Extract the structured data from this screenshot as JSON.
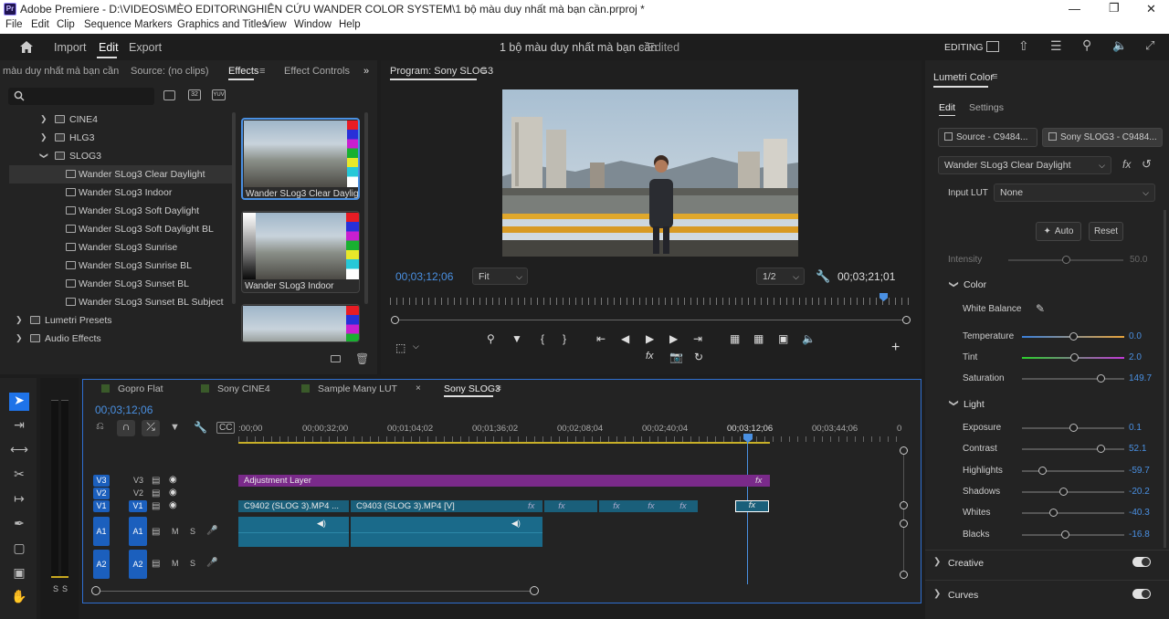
{
  "title_bar": {
    "text": "Adobe Premiere - D:\\VIDEOS\\MÈO EDITOR\\NGHIÊN CỨU WANDER COLOR SYSTEM\\1 bộ màu duy nhất mà bạn cần.prproj *",
    "app_icon": "Pr"
  },
  "menu": [
    "File",
    "Edit",
    "Clip",
    "Sequence",
    "Markers",
    "Graphics and Titles",
    "View",
    "Window",
    "Help"
  ],
  "workspace": {
    "import": "Import",
    "edit": "Edit",
    "export": "Export",
    "project_name": "1 bộ màu duy nhất mà bạn cần",
    "status": "- Edited",
    "mode": "EDITING"
  },
  "left_panel": {
    "tabs": [
      "màu duy nhất mà bạn cần",
      "Source: (no clips)",
      "Effects",
      "Effect Controls"
    ],
    "tree": [
      {
        "label": "CINE4",
        "type": "folder",
        "expanded": false
      },
      {
        "label": "HLG3",
        "type": "folder",
        "expanded": false
      },
      {
        "label": "SLOG3",
        "type": "folder",
        "expanded": true
      },
      {
        "label": "Wander SLog3 Clear Daylight",
        "type": "preset",
        "selected": true
      },
      {
        "label": "Wander SLog3 Indoor",
        "type": "preset"
      },
      {
        "label": "Wander SLog3 Soft Daylight",
        "type": "preset"
      },
      {
        "label": "Wander SLog3 Soft Daylight BL",
        "type": "preset"
      },
      {
        "label": "Wander SLog3 Sunrise",
        "type": "preset"
      },
      {
        "label": "Wander SLog3 Sunrise BL",
        "type": "preset"
      },
      {
        "label": "Wander SLog3 Sunset BL",
        "type": "preset"
      },
      {
        "label": "Wander SLog3 Sunset BL Subject",
        "type": "preset"
      },
      {
        "label": "Lumetri Presets",
        "type": "folder",
        "expanded": false
      },
      {
        "label": "Audio Effects",
        "type": "folder",
        "expanded": false
      }
    ],
    "thumbnails": [
      "Wander SLog3 Clear Daylight",
      "Wander SLog3 Indoor",
      ""
    ],
    "search_badges": [
      "32",
      "YUV"
    ]
  },
  "program": {
    "tab": "Program: Sony SLOG3",
    "timecode": "00;03;12;06",
    "fit": "Fit",
    "resolution": "1/2",
    "duration": "00;03;21;01"
  },
  "lumetri": {
    "tab": "Lumetri Color",
    "subtabs": [
      "Edit",
      "Settings"
    ],
    "source": "Source - C9484...",
    "sequence": "Sony SLOG3 - C9484...",
    "preset": "Wander SLog3 Clear Daylight",
    "input_lut_label": "Input LUT",
    "input_lut": "None",
    "auto": "Auto",
    "reset": "Reset",
    "intensity": {
      "label": "Intensity",
      "value": "50.0",
      "fraction": 0.5
    },
    "color_section": "Color",
    "white_balance": "White Balance",
    "color_sliders": [
      {
        "label": "Temperature",
        "value": "0.0",
        "fraction": 0.5
      },
      {
        "label": "Tint",
        "value": "2.0",
        "fraction": 0.51
      },
      {
        "label": "Saturation",
        "value": "149.7",
        "fraction": 0.77
      }
    ],
    "light_section": "Light",
    "light_sliders": [
      {
        "label": "Exposure",
        "value": "0.1",
        "fraction": 0.5
      },
      {
        "label": "Contrast",
        "value": "52.1",
        "fraction": 0.77
      },
      {
        "label": "Highlights",
        "value": "-59.7",
        "fraction": 0.2
      },
      {
        "label": "Shadows",
        "value": "-20.2",
        "fraction": 0.4
      },
      {
        "label": "Whites",
        "value": "-40.3",
        "fraction": 0.3
      },
      {
        "label": "Blacks",
        "value": "-16.8",
        "fraction": 0.42
      }
    ],
    "creative": "Creative",
    "curves": "Curves",
    "colors": {
      "accent": "#4a90e2",
      "tint_left": "#2bd12b",
      "tint_right": "#c238d8",
      "temp_left": "#3a7fd9",
      "temp_right": "#e8a33a"
    }
  },
  "timeline": {
    "sequences": [
      {
        "name": "Gopro Flat",
        "swatch": "#3a5a2a"
      },
      {
        "name": "Sony CINE4",
        "swatch": "#3a5a2a"
      },
      {
        "name": "Sample Many LUT",
        "swatch": "#3a5a2a"
      },
      {
        "name": "Sony SLOG3",
        "swatch": "#3a5a2a",
        "active": true
      }
    ],
    "timecode": "00;03;12;06",
    "ruler": [
      ":00;00",
      "00;00;32;00",
      "00;01;04;02",
      "00;01;36;02",
      "00;02;08;04",
      "00;02;40;04",
      "00;03;12;06",
      "00;03;44;06",
      "0"
    ],
    "tracks": {
      "v3": "V3",
      "v2": "V2",
      "v1": "V1",
      "a1": "A1",
      "a2": "A2",
      "m": "M",
      "s": "S"
    },
    "clips": {
      "adjustment": "Adjustment Layer",
      "c9402": "C9402 (SLOG 3).MP4 ...",
      "c9403": "C9403 (SLOG 3).MP4 [V]",
      "fx": "fx"
    },
    "colors": {
      "video": "#1a5f7a",
      "adjustment": "#7a2a8a",
      "audio": "#1a6a8a"
    }
  },
  "audio_meter": {
    "s1": "S",
    "s2": "S"
  }
}
